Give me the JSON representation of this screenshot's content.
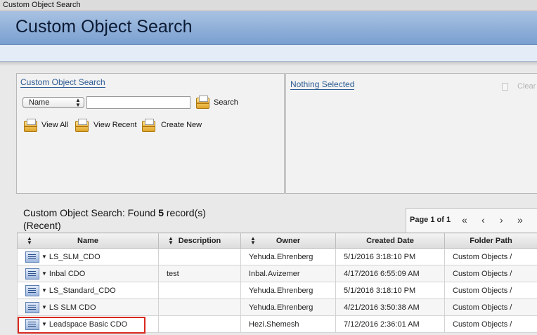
{
  "window": {
    "title": "Custom Object Search"
  },
  "header": {
    "title": "Custom Object Search"
  },
  "search_panel": {
    "title": "Custom Object Search",
    "field_select": "Name",
    "search_value": "",
    "search_label": "Search",
    "view_all_label": "View All",
    "view_recent_label": "View Recent",
    "create_new_label": "Create New"
  },
  "selection_panel": {
    "title": "Nothing Selected",
    "clear_label": "Clear"
  },
  "results": {
    "prefix": "Custom Object Search: Found ",
    "count": "5",
    "suffix": " record(s)",
    "subtitle": "(Recent)",
    "page_label": "Page 1 of 1",
    "nav": {
      "first": "«",
      "prev": "‹",
      "next": "›",
      "last": "»"
    }
  },
  "table": {
    "columns": [
      "Name",
      "Description",
      "Owner",
      "Created Date",
      "Folder Path"
    ],
    "rows": [
      {
        "name": "LS_SLM_CDO",
        "description": "",
        "owner": "Yehuda.Ehrenberg",
        "created": "5/1/2016 3:18:10 PM",
        "folder": "Custom Objects /"
      },
      {
        "name": "Inbal CDO",
        "description": "test",
        "owner": "Inbal.Avizemer",
        "created": "4/17/2016 6:55:09 AM",
        "folder": "Custom Objects /"
      },
      {
        "name": "LS_Standard_CDO",
        "description": "",
        "owner": "Yehuda.Ehrenberg",
        "created": "5/1/2016 3:18:10 PM",
        "folder": "Custom Objects /"
      },
      {
        "name": "LS SLM CDO",
        "description": "",
        "owner": "Yehuda.Ehrenberg",
        "created": "4/21/2016 3:50:38 AM",
        "folder": "Custom Objects /"
      },
      {
        "name": "Leadspace Basic CDO",
        "description": "",
        "owner": "Hezi.Shemesh",
        "created": "7/12/2016 2:36:01 AM",
        "folder": "Custom Objects /"
      }
    ]
  },
  "colors": {
    "header_top": "#a9c2e2",
    "header_bottom": "#7a9fd0",
    "link_blue": "#2d5c94",
    "highlight_red": "#d9281f"
  }
}
